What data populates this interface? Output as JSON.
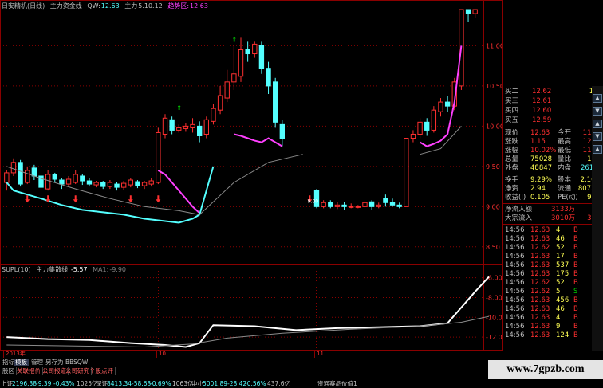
{
  "main_title": {
    "name": "日安精机(日线)",
    "indicator": "主力资金线",
    "qw_label": "QW:",
    "qw_value": "12.63",
    "zl_label": "主力",
    "zl_value": "5.10.12",
    "qs_label": "趋势区:",
    "qs_value": "12.63"
  },
  "sub_title": {
    "name": "SUPL(10)",
    "indicator": "主力集散线:",
    "value": "-5.57",
    "ma_label": "MA1:",
    "ma_value": "-9.90"
  },
  "price_axis": [
    "11.00",
    "10.50",
    "10.00",
    "9.50",
    "9.00",
    "8.50"
  ],
  "sub_axis": [
    "-6.00",
    "-8.00",
    "-10.00",
    "-12.00"
  ],
  "date_labels": [
    "2013年",
    "10",
    "11"
  ],
  "annotation_900": "9.00",
  "quotes": [
    {
      "label": "买二",
      "price": "12.62",
      "vol": "155"
    },
    {
      "label": "买三",
      "price": "12.61",
      "vol": "15"
    },
    {
      "label": "买四",
      "price": "12.60",
      "vol": "22"
    },
    {
      "label": "买五",
      "price": "12.59",
      "vol": "68"
    }
  ],
  "stats": [
    {
      "l1": "现价",
      "v1": "12.63",
      "l2": "今开",
      "v2": "11.30"
    },
    {
      "l1": "涨跌",
      "v1": "1.15",
      "l2": "最高",
      "v2": "12.63"
    },
    {
      "l1": "涨幅",
      "v1": "10.02%",
      "l2": "最低",
      "v2": "11.28"
    },
    {
      "l1": "总量",
      "v1": "75028",
      "l2": "量比",
      "v2": "1.95"
    },
    {
      "l1": "外盘",
      "v1": "48847",
      "l2": "内盘",
      "v2": "26181"
    }
  ],
  "stats2": [
    {
      "l1": "换手",
      "v1": "9.29%",
      "l2": "股本",
      "v2": "2.16亿"
    },
    {
      "l1": "净资",
      "v1": "2.94",
      "l2": "流通",
      "v2": "8073万"
    },
    {
      "l1": "收益(I)",
      "v1": "0.105",
      "l2": "PE(动)",
      "v2": "90.5"
    }
  ],
  "flows": [
    {
      "label": "净流入额",
      "value": "3133万",
      "pct": "5%"
    },
    {
      "label": "大宗流入",
      "value": "3010万",
      "pct": "33%"
    }
  ],
  "ticks": [
    {
      "time": "14:56",
      "price": "12.63",
      "vol": "4",
      "side": "B"
    },
    {
      "time": "14:56",
      "price": "12.63",
      "vol": "46",
      "side": "B"
    },
    {
      "time": "14:56",
      "price": "12.62",
      "vol": "52",
      "side": "B"
    },
    {
      "time": "14:56",
      "price": "12.63",
      "vol": "17",
      "side": "B"
    },
    {
      "time": "14:56",
      "price": "12.63",
      "vol": "537",
      "side": "B"
    },
    {
      "time": "14:56",
      "price": "12.63",
      "vol": "175",
      "side": "B"
    },
    {
      "time": "14:56",
      "price": "12.62",
      "vol": "52",
      "side": "B"
    },
    {
      "time": "14:56",
      "price": "12.62",
      "vol": "5",
      "side": "S"
    },
    {
      "time": "14:56",
      "price": "12.63",
      "vol": "456",
      "side": "B"
    },
    {
      "time": "14:56",
      "price": "12.63",
      "vol": "46",
      "side": "B"
    },
    {
      "time": "14:56",
      "price": "12.63",
      "vol": "4",
      "side": "B"
    },
    {
      "time": "14:56",
      "price": "12.63",
      "vol": "9",
      "side": "B"
    },
    {
      "time": "14:56",
      "price": "12.63",
      "vol": "124",
      "side": "B"
    }
  ],
  "tabs_row1": [
    "指标",
    "模板",
    "管理",
    "另存为",
    "BBSQW"
  ],
  "tabs_row2": [
    "股区",
    "关联报价",
    "公司报道",
    "公司研究",
    "个股点评"
  ],
  "status": {
    "sh_label": "上证",
    "sh_value": "2196.38",
    "sh_chg": "-9.39",
    "sh_pct": "-0.43%",
    "sh_amt": "1025亿",
    "sz_label": "深证",
    "sz_value": "8413.34",
    "sz_chg": "-58.68",
    "sz_pct": "-0.69%",
    "sz_amt": "1063亿",
    "zx_label": "中小",
    "zx_value": "5001.89",
    "zx_chg": "-28.42",
    "zx_pct": "-0.56%",
    "zx_amt": "437.6亿",
    "right": "资通赛品价值1"
  },
  "watermark": "www.7gpzb.com",
  "colors": {
    "up": "#ff3030",
    "down": "#54ffff",
    "price": "#ffff54",
    "text": "#c0c0c0",
    "frame": "#8a0000",
    "white": "#ffffff",
    "magenta": "#ff40ff",
    "green": "#00d000"
  },
  "chart_data": {
    "type": "candlestick",
    "price_ylim": [
      8.3,
      11.45
    ],
    "candles": [
      [
        9.3,
        9.42,
        9.2,
        9.45
      ],
      [
        9.42,
        9.55,
        9.38,
        9.6
      ],
      [
        9.55,
        9.28,
        9.25,
        9.58
      ],
      [
        9.3,
        9.45,
        9.28,
        9.5
      ],
      [
        9.48,
        9.38,
        9.33,
        9.52
      ],
      [
        9.38,
        9.24,
        9.2,
        9.4
      ],
      [
        9.22,
        9.4,
        9.2,
        9.45
      ],
      [
        9.4,
        9.34,
        9.3,
        9.42
      ],
      [
        9.33,
        9.28,
        9.22,
        9.36
      ],
      [
        9.28,
        9.34,
        9.25,
        9.38
      ],
      [
        9.3,
        9.4,
        9.28,
        9.45
      ],
      [
        9.38,
        9.32,
        9.27,
        9.4
      ],
      [
        9.32,
        9.28,
        9.25,
        9.35
      ],
      [
        9.27,
        9.3,
        9.24,
        9.32
      ],
      [
        9.3,
        9.25,
        9.22,
        9.32
      ],
      [
        9.25,
        9.3,
        9.22,
        9.33
      ],
      [
        9.28,
        9.24,
        9.2,
        9.31
      ],
      [
        9.24,
        9.29,
        9.21,
        9.32
      ],
      [
        9.27,
        9.33,
        9.24,
        9.36
      ],
      [
        9.31,
        9.26,
        9.23,
        9.33
      ],
      [
        9.26,
        9.3,
        9.22,
        9.32
      ],
      [
        9.28,
        9.32,
        9.25,
        9.35
      ],
      [
        9.3,
        9.92,
        9.28,
        9.98
      ],
      [
        9.9,
        10.1,
        9.85,
        10.15
      ],
      [
        10.08,
        9.95,
        9.9,
        10.12
      ],
      [
        9.95,
        9.98,
        9.92,
        10.02
      ],
      [
        9.97,
        10.0,
        9.93,
        10.04
      ],
      [
        9.98,
        10.02,
        9.92,
        10.1
      ],
      [
        10.0,
        9.88,
        9.8,
        10.06
      ],
      [
        9.9,
        10.08,
        9.85,
        10.12
      ],
      [
        10.06,
        10.22,
        10.02,
        10.28
      ],
      [
        10.2,
        10.38,
        10.15,
        10.5
      ],
      [
        10.35,
        10.55,
        10.3,
        10.7
      ],
      [
        10.55,
        10.65,
        10.45,
        11.0
      ],
      [
        10.62,
        10.95,
        10.55,
        11.1
      ],
      [
        10.95,
        10.9,
        10.8,
        11.05
      ],
      [
        10.9,
        11.02,
        10.85,
        11.05
      ],
      [
        11.0,
        10.72,
        10.65,
        11.05
      ],
      [
        10.72,
        10.5,
        10.4,
        10.8
      ],
      [
        10.55,
        10.05,
        9.98,
        10.6
      ],
      [
        10.02,
        9.85,
        9.75,
        10.08
      ],
      [
        9.85,
        9.85,
        9.85,
        9.85
      ],
      [
        9.85,
        9.85,
        9.85,
        9.85
      ],
      [
        9.85,
        9.85,
        9.85,
        9.85
      ],
      [
        9.85,
        9.85,
        9.85,
        9.85
      ],
      [
        9.2,
        9.0,
        8.98,
        9.22
      ],
      [
        9.0,
        9.05,
        8.98,
        9.08
      ],
      [
        9.05,
        9.0,
        8.98,
        9.08
      ],
      [
        9.0,
        9.02,
        8.97,
        9.06
      ],
      [
        9.02,
        9.0,
        8.96,
        9.06
      ],
      [
        9.0,
        9.0,
        8.98,
        9.04
      ],
      [
        9.0,
        9.0,
        8.98,
        9.02
      ],
      [
        9.0,
        9.05,
        8.98,
        9.08
      ],
      [
        9.06,
        9.0,
        8.96,
        9.08
      ],
      [
        9.0,
        9.02,
        8.98,
        9.05
      ],
      [
        9.1,
        9.05,
        9.0,
        9.15
      ],
      [
        9.05,
        9.02,
        9.0,
        9.1
      ],
      [
        9.02,
        9.0,
        8.98,
        9.05
      ],
      [
        9.0,
        9.85,
        9.98,
        9.98
      ],
      [
        9.85,
        9.9,
        9.8,
        9.95
      ],
      [
        9.9,
        10.05,
        9.85,
        10.1
      ],
      [
        10.05,
        9.95,
        9.88,
        10.1
      ],
      [
        9.95,
        10.2,
        9.92,
        10.25
      ],
      [
        10.18,
        10.3,
        10.12,
        10.35
      ],
      [
        10.3,
        10.25,
        10.18,
        10.38
      ],
      [
        10.25,
        10.55,
        10.2,
        10.6
      ],
      [
        10.5,
        11.45,
        10.45,
        11.45
      ],
      [
        11.45,
        11.4,
        11.3,
        11.45
      ],
      [
        11.4,
        11.45,
        11.35,
        11.45
      ]
    ],
    "magenta_line": [
      [
        22,
        9.45
      ],
      [
        23,
        9.4
      ],
      [
        24,
        9.3
      ],
      [
        25,
        9.2
      ],
      [
        26,
        9.1
      ],
      [
        27,
        9.0
      ],
      [
        28,
        8.92
      ],
      [
        33,
        9.9
      ],
      [
        34,
        9.88
      ],
      [
        35,
        9.85
      ],
      [
        36,
        9.82
      ],
      [
        37,
        9.8
      ],
      [
        38,
        9.85
      ],
      [
        39,
        9.8
      ],
      [
        40,
        9.75
      ],
      [
        60,
        9.8
      ],
      [
        61,
        9.75
      ],
      [
        62,
        9.78
      ],
      [
        63,
        9.82
      ],
      [
        64,
        9.9
      ],
      [
        65,
        10.3
      ],
      [
        66,
        11.0
      ]
    ],
    "blue_line": [
      [
        0,
        9.3
      ],
      [
        1,
        9.2
      ],
      [
        3,
        9.15
      ],
      [
        5,
        9.1
      ],
      [
        8,
        9.02
      ],
      [
        11,
        8.96
      ],
      [
        14,
        8.93
      ],
      [
        17,
        8.9
      ],
      [
        20,
        8.85
      ],
      [
        23,
        8.82
      ],
      [
        25,
        8.8
      ],
      [
        27,
        8.85
      ],
      [
        28,
        8.9
      ],
      [
        29,
        9.2
      ],
      [
        30,
        9.5
      ]
    ],
    "ma_line": [
      [
        0,
        9.5
      ],
      [
        5,
        9.35
      ],
      [
        10,
        9.22
      ],
      [
        15,
        9.1
      ],
      [
        20,
        9.0
      ],
      [
        25,
        8.95
      ],
      [
        28,
        8.9
      ],
      [
        33,
        9.3
      ],
      [
        38,
        9.55
      ],
      [
        43,
        9.65
      ],
      [
        60,
        9.65
      ],
      [
        63,
        9.72
      ],
      [
        66,
        10.0
      ]
    ],
    "sub_ylim": [
      -13.2,
      -5.3
    ],
    "supl_line": [
      [
        0,
        -12.0
      ],
      [
        6,
        -12.2
      ],
      [
        12,
        -12.3
      ],
      [
        18,
        -12.6
      ],
      [
        23,
        -12.8
      ],
      [
        26,
        -13.0
      ],
      [
        28,
        -12.6
      ],
      [
        30,
        -10.8
      ],
      [
        36,
        -10.9
      ],
      [
        42,
        -11.3
      ],
      [
        48,
        -11.1
      ],
      [
        54,
        -11.0
      ],
      [
        60,
        -10.9
      ],
      [
        64,
        -10.6
      ],
      [
        66,
        -9.0
      ],
      [
        68,
        -7.4
      ],
      [
        70,
        -5.9
      ]
    ],
    "supl_ma": [
      [
        0,
        -12.8
      ],
      [
        10,
        -12.9
      ],
      [
        20,
        -13.0
      ],
      [
        27,
        -12.7
      ],
      [
        32,
        -12.1
      ],
      [
        40,
        -11.6
      ],
      [
        50,
        -11.2
      ],
      [
        60,
        -10.9
      ],
      [
        66,
        -10.5
      ],
      [
        70,
        -9.9
      ]
    ]
  }
}
